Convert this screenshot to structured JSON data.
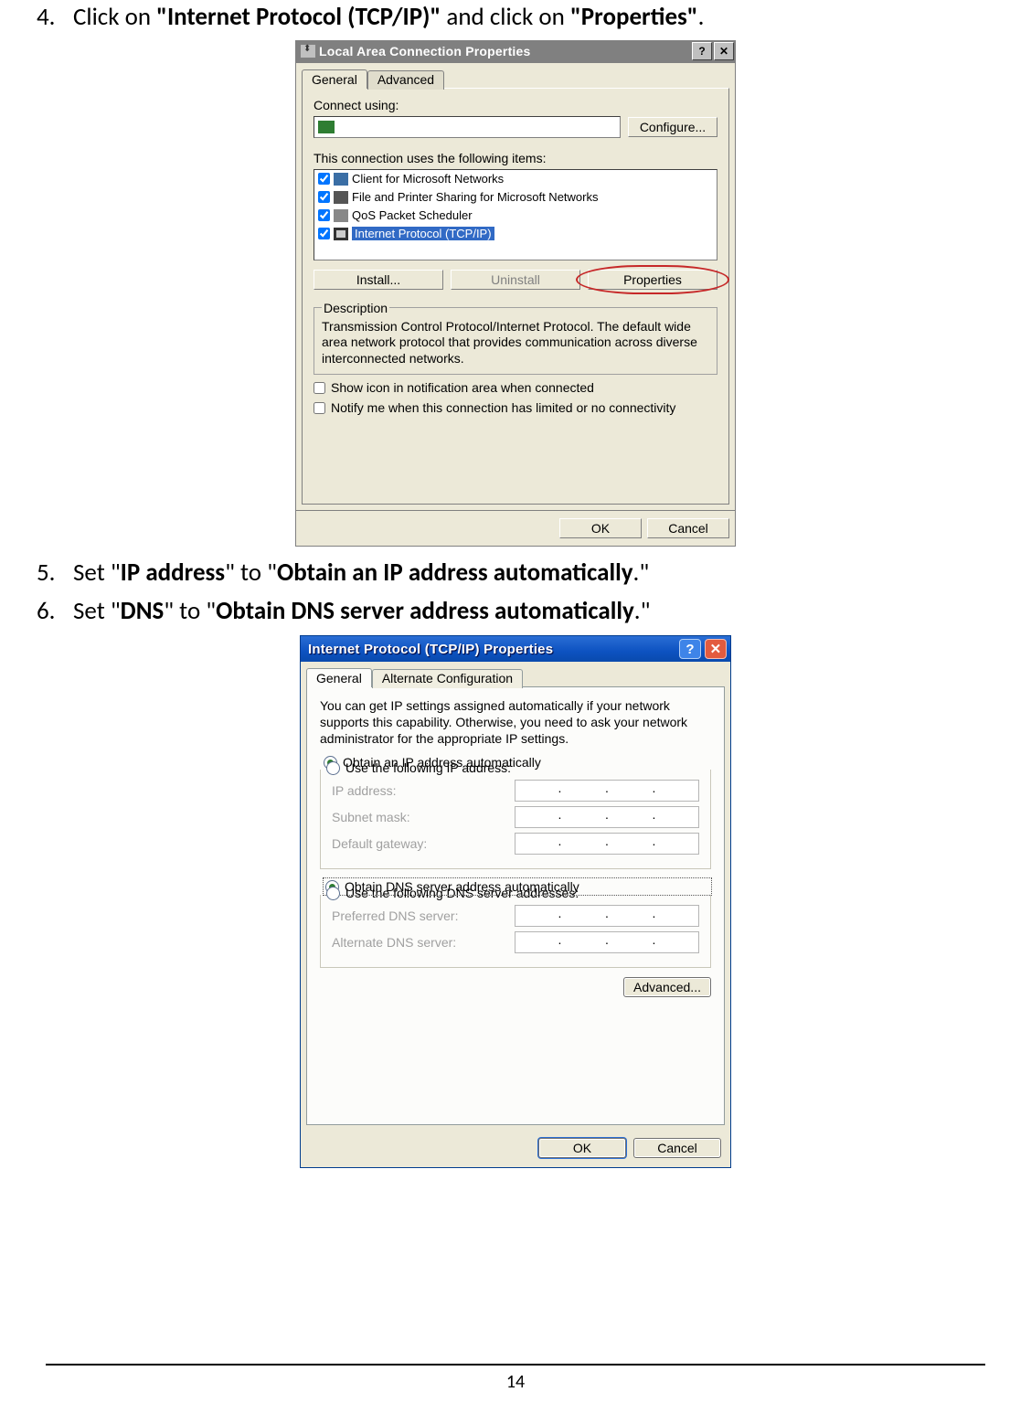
{
  "steps": {
    "s4": {
      "num": "4.",
      "pre": "Click on ",
      "bold1": "\"Internet Protocol (TCP/IP)\"",
      "mid": " and click on ",
      "bold2": "\"Properties\"",
      "post": "."
    },
    "s5": {
      "num": "5.",
      "pre": "Set \"",
      "bold1": "IP address",
      "mid": "\" to \"",
      "bold2": "Obtain an IP address automatically",
      "post": ".\""
    },
    "s6": {
      "num": "6.",
      "pre": "Set \"",
      "bold1": "DNS",
      "mid": "\" to \"",
      "bold2": "Obtain DNS server address automatically",
      "post": ".\""
    }
  },
  "shot1": {
    "title": "Local Area Connection    Properties",
    "help_btn": "?",
    "close_btn": "✕",
    "tab_general": "General",
    "tab_advanced": "Advanced",
    "connect_using": "Connect using:",
    "configure_btn": "Configure...",
    "items_label": "This connection uses the following items:",
    "items": [
      "Client for Microsoft Networks",
      "File and Printer Sharing for Microsoft Networks",
      "QoS Packet Scheduler",
      "Internet Protocol (TCP/IP)"
    ],
    "install_btn": "Install...",
    "uninstall_btn": "Uninstall",
    "properties_btn": "Properties",
    "desc_legend": "Description",
    "desc_text": "Transmission Control Protocol/Internet Protocol. The default wide area network protocol that provides communication across diverse interconnected networks.",
    "chk_show_icon": "Show icon in notification area when connected",
    "chk_notify": "Notify me when this connection has limited or no connectivity",
    "ok_btn": "OK",
    "cancel_btn": "Cancel"
  },
  "shot2": {
    "title": "Internet Protocol (TCP/IP) Properties",
    "help_btn": "?",
    "close_btn": "✕",
    "tab_general": "General",
    "tab_alt": "Alternate Configuration",
    "intro": "You can get IP settings assigned automatically if your network supports this capability. Otherwise, you need to ask your network administrator for the appropriate IP settings.",
    "radio_obtain_ip": "Obtain an IP address automatically",
    "radio_use_ip": "Use the following IP address:",
    "lbl_ip": "IP address:",
    "lbl_subnet": "Subnet mask:",
    "lbl_gateway": "Default gateway:",
    "radio_obtain_dns": "Obtain DNS server address automatically",
    "radio_use_dns": "Use the following DNS server addresses:",
    "lbl_pref_dns": "Preferred DNS server:",
    "lbl_alt_dns": "Alternate DNS server:",
    "advanced_btn": "Advanced...",
    "ok_btn": "OK",
    "cancel_btn": "Cancel"
  },
  "page_number": "14"
}
